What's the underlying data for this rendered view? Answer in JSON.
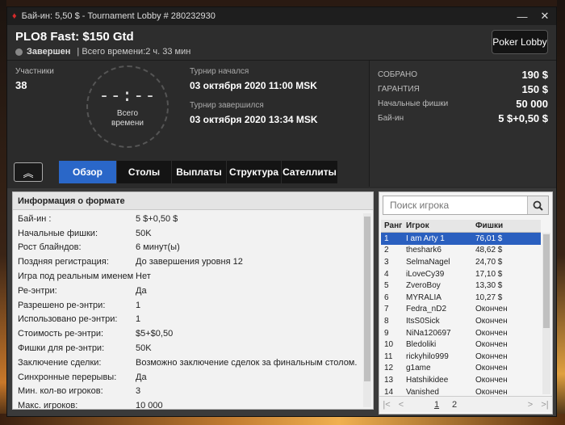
{
  "window": {
    "title": "Бай-ин: 5,50 $ - Tournament Lobby # 280232930",
    "buttons": {
      "minimize": "—",
      "close": "✕"
    }
  },
  "header": {
    "tournament_name": "PLO8 Fast: $150 Gtd",
    "status": "Завершен",
    "total_time": "| Всего времени:2 ч. 33 мин",
    "poker_lobby_label": "Poker Lobby"
  },
  "info": {
    "participants_label": "Участники",
    "participants_value": "38",
    "clock_time": "--:--",
    "clock_caption_line1": "Всего",
    "clock_caption_line2": "времени",
    "started_label": "Турнир начался",
    "started_value": "03 октября 2020  11:00 MSK",
    "ended_label": "Турнир завершился",
    "ended_value": "03 октября 2020  13:34 MSK"
  },
  "prize": [
    {
      "label": "СОБРАНО",
      "value": "190 $"
    },
    {
      "label": "ГАРАНТИЯ",
      "value": "150 $"
    },
    {
      "label": "Начальные фишки",
      "value": "50 000"
    },
    {
      "label": "Бай-ин",
      "value": "5 $+0,50 $"
    }
  ],
  "tabs": [
    "Обзор",
    "Столы",
    "Выплаты",
    "Структура",
    "Сателлиты"
  ],
  "format": {
    "title": "Информация о формате",
    "rows": [
      {
        "k": "Бай-ин :",
        "v": "5 $+0,50 $"
      },
      {
        "k": "Начальные фишки:",
        "v": "50K"
      },
      {
        "k": "Рост блайндов:",
        "v": "6 минут(ы)"
      },
      {
        "k": "Поздняя регистрация:",
        "v": "До завершения уровня 12"
      },
      {
        "k": "Игра под реальным именем",
        "v": "Нет"
      },
      {
        "k": "Ре-энтри:",
        "v": "Да"
      },
      {
        "k": "Разрешено ре-энтри:",
        "v": "1"
      },
      {
        "k": "Использовано ре-энтри:",
        "v": "1"
      },
      {
        "k": "Стоимость ре-энтри:",
        "v": "$5+$0,50"
      },
      {
        "k": "Фишки для ре-энтри:",
        "v": "50K"
      },
      {
        "k": "Заключение сделки:",
        "v": "Возможно заключение сделок за финальным столом."
      },
      {
        "k": "Синхронные перерывы:",
        "v": "Да"
      },
      {
        "k": "Мин. кол-во игроков:",
        "v": "3"
      },
      {
        "k": "Макс. игроков:",
        "v": "10 000"
      }
    ]
  },
  "players": {
    "search_placeholder": "Поиск игрока",
    "headers": {
      "rank": "Ранг",
      "name": "Игрок",
      "chips": "Фишки"
    },
    "rows": [
      {
        "rank": "1",
        "name": "I am Arty 1",
        "chips": "76,01 $"
      },
      {
        "rank": "2",
        "name": "theshark6",
        "chips": "48,62 $"
      },
      {
        "rank": "3",
        "name": "SelmaNagel",
        "chips": "24,70 $"
      },
      {
        "rank": "4",
        "name": "iLoveCy39",
        "chips": "17,10 $"
      },
      {
        "rank": "5",
        "name": "ZveroBoy",
        "chips": "13,30 $"
      },
      {
        "rank": "6",
        "name": "MYRALIA",
        "chips": "10,27 $"
      },
      {
        "rank": "7",
        "name": "Fedra_nD2",
        "chips": "Окончен"
      },
      {
        "rank": "8",
        "name": "ItsS0Sick",
        "chips": "Окончен"
      },
      {
        "rank": "9",
        "name": "NiNa120697",
        "chips": "Окончен"
      },
      {
        "rank": "10",
        "name": "Bledoliki",
        "chips": "Окончен"
      },
      {
        "rank": "11",
        "name": "rickyhilo999",
        "chips": "Окончен"
      },
      {
        "rank": "12",
        "name": "g1ame",
        "chips": "Окончен"
      },
      {
        "rank": "13",
        "name": "Hatshikidee",
        "chips": "Окончен"
      },
      {
        "rank": "14",
        "name": "Vanished",
        "chips": "Окончен"
      }
    ],
    "pager": {
      "first": "|<",
      "prev": "<",
      "page1": "1",
      "page2": "2",
      "next": ">",
      "last": ">|"
    }
  },
  "colors": {
    "accent": "#2a67c8",
    "selected_row": "#2a5fbf",
    "brand": "#d42b2b"
  }
}
